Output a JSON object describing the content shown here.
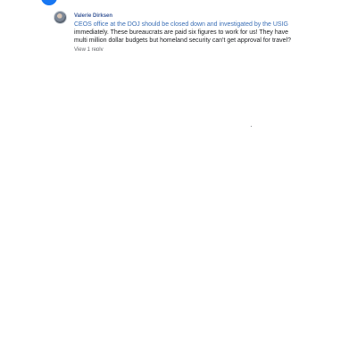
{
  "nav": {
    "logo_icon": "facebook-logo-icon",
    "icons": [
      "home-icon",
      "watch-icon",
      "marketplace-icon",
      "groups-icon",
      "gaming-icon",
      "menu-icon",
      "messenger-icon"
    ]
  },
  "comment": {
    "author": "Valerie Dirksen",
    "text_lead": "CEOS office at the DOJ should be closed down and investigated by the USIG",
    "text_rest": "immediately. These bureaucrats are paid six figures to work for us! They have multi million dollar budgets but homeland security can't get approval for travel?",
    "view_replies": "View 1 reply"
  },
  "colors": {
    "brand": "#1877f2",
    "author": "#3b5998",
    "link": "#3b6fb6",
    "text": "#1c1e21"
  }
}
